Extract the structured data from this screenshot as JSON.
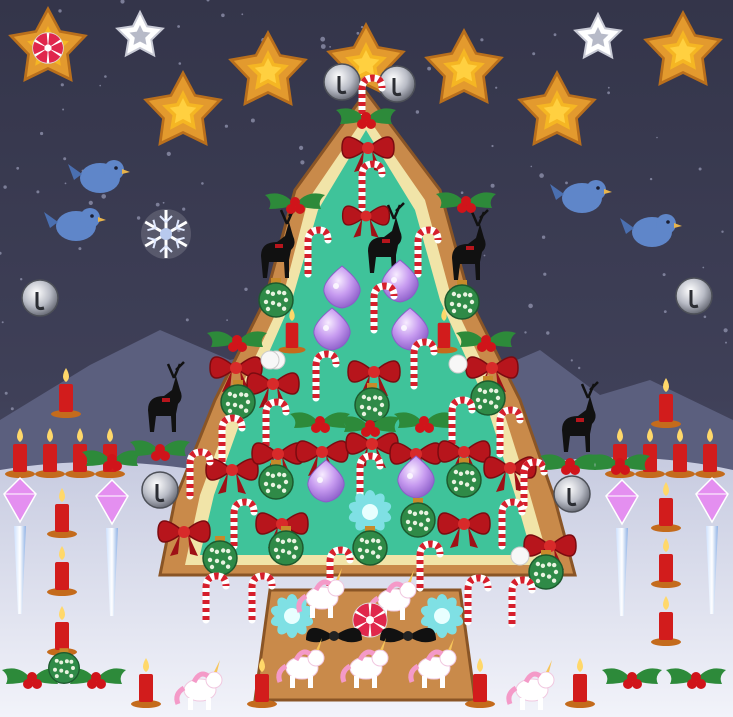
{
  "scene": {
    "type": "mahjong-style tile-matching puzzle board",
    "theme": "christmas-tree",
    "colors": {
      "sky": "#3a3b52",
      "snow": "#e9ecf6",
      "mountain": "#5b5f7e",
      "tree_green": "#3fc39a",
      "tree_rim": "#f1e4a8",
      "gingerbread": "#c98a4a",
      "bow_red": "#b7151c",
      "holly_green": "#2d8a3a",
      "candle_red": "#d21c1c",
      "star_orange": "#e39a2e",
      "bird_blue": "#5f86c9",
      "crystal_pink": "#e48ff0"
    },
    "tile_kinds": [
      "star-ornament",
      "white-star",
      "peppermint-candy",
      "silver-bell",
      "blue-bird",
      "snowflake",
      "reindeer",
      "candy-cane",
      "red-bow",
      "holly",
      "green-bauble",
      "purple-onion-ornament",
      "candle",
      "crystal-icicle",
      "teal-flower",
      "unicorn",
      "black-bow",
      "white-pearl"
    ]
  }
}
